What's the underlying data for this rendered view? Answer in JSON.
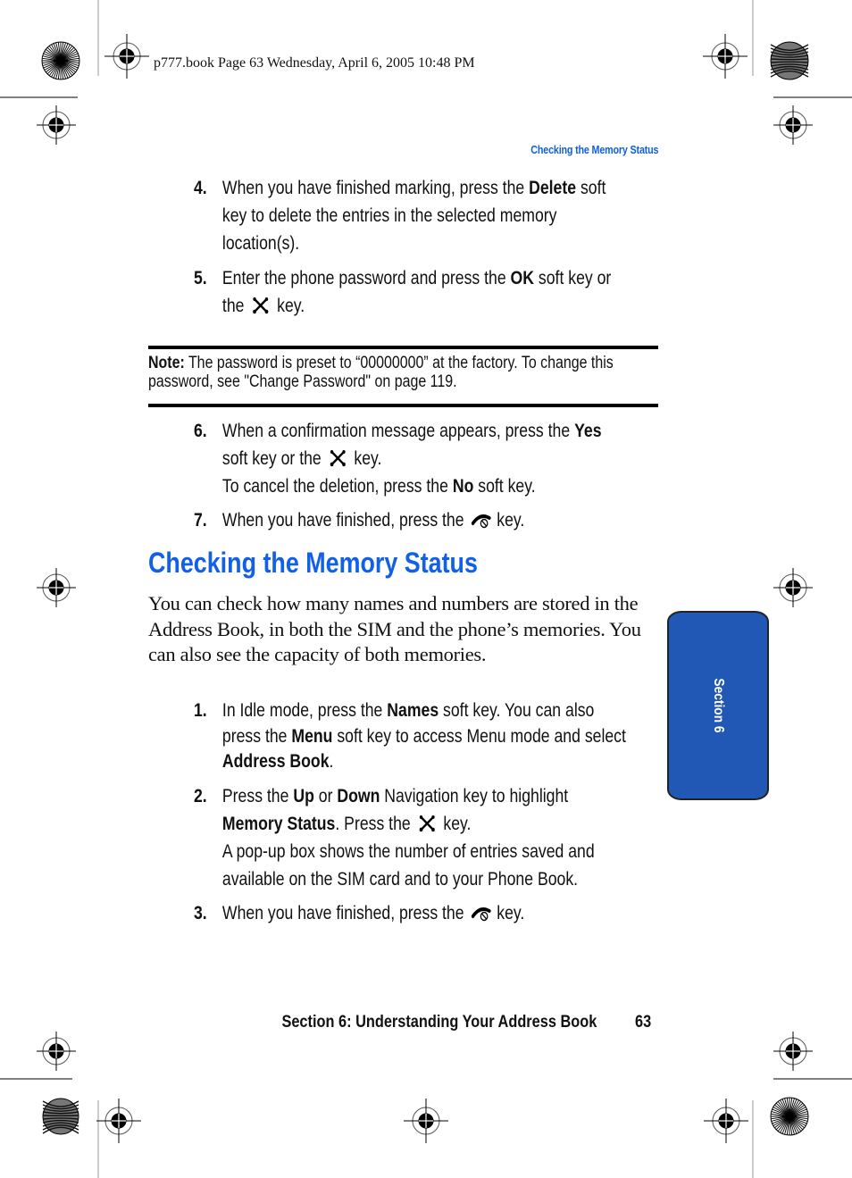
{
  "slug": "p777.book  Page 63  Wednesday, April 6, 2005  10:48 PM",
  "running_head": "Checking the Memory Status",
  "steps_a": [
    {
      "num": "4.",
      "parts": [
        {
          "t": "When you have finished marking, press the "
        },
        {
          "t": "Delete",
          "b": true
        },
        {
          "t": " soft key to delete the entries in the selected memory location(s)."
        }
      ]
    },
    {
      "num": "5.",
      "parts": [
        {
          "t": "Enter the phone password and press the "
        },
        {
          "t": "OK",
          "b": true
        },
        {
          "t": " soft key or the "
        },
        {
          "icon": "menu-ok-key-icon"
        },
        {
          "t": " key."
        }
      ]
    }
  ],
  "note": {
    "label": "Note:",
    "text": " The password is preset to “00000000” at the factory. To change this password, see \"Change Password\" on page 119."
  },
  "steps_b": [
    {
      "num": "6.",
      "parts": [
        {
          "t": "When a confirmation message appears, press the "
        },
        {
          "t": "Yes",
          "b": true
        },
        {
          "t": " soft key or the "
        },
        {
          "icon": "menu-ok-key-icon"
        },
        {
          "t": " key."
        },
        {
          "br": true
        },
        {
          "t": "To cancel the deletion, press the "
        },
        {
          "t": "No",
          "b": true
        },
        {
          "t": " soft key."
        }
      ]
    },
    {
      "num": "7.",
      "parts": [
        {
          "t": "When you have finished, press the "
        },
        {
          "icon": "end-key-icon"
        },
        {
          "t": " key."
        }
      ]
    }
  ],
  "section_heading": "Checking the Memory Status",
  "intro": "You can check how many names and numbers are stored in the Address Book, in both the SIM and the phone’s memories. You can also see the capacity of both memories.",
  "steps_c": [
    {
      "num": "1.",
      "parts": [
        {
          "t": "In Idle mode, press the "
        },
        {
          "t": "Names",
          "b": true
        },
        {
          "t": " soft key. You can also press the "
        },
        {
          "t": "Menu",
          "b": true
        },
        {
          "t": " soft key to access Menu mode and select "
        },
        {
          "t": "Address Book",
          "b": true
        },
        {
          "t": "."
        }
      ]
    },
    {
      "num": "2.",
      "parts": [
        {
          "t": "Press the "
        },
        {
          "t": "Up",
          "b": true
        },
        {
          "t": " or "
        },
        {
          "t": "Down",
          "b": true
        },
        {
          "t": " Navigation key to highlight "
        },
        {
          "t": "Memory Status",
          "b": true
        },
        {
          "t": ".  Press the "
        },
        {
          "icon": "menu-ok-key-icon"
        },
        {
          "t": " key."
        },
        {
          "br": true
        },
        {
          "t": "A pop-up box shows the number of entries saved and available on the SIM card and to your Phone Book."
        }
      ]
    },
    {
      "num": "3.",
      "parts": [
        {
          "t": "When you have finished, press the "
        },
        {
          "icon": "end-key-icon"
        },
        {
          "t": " key."
        }
      ]
    }
  ],
  "side_tab": "Section 6",
  "footer": {
    "title": "Section 6: Understanding Your Address Book",
    "page": "63"
  },
  "colors": {
    "accent_blue": "#1060e8",
    "tab_blue": "#2158b5"
  }
}
